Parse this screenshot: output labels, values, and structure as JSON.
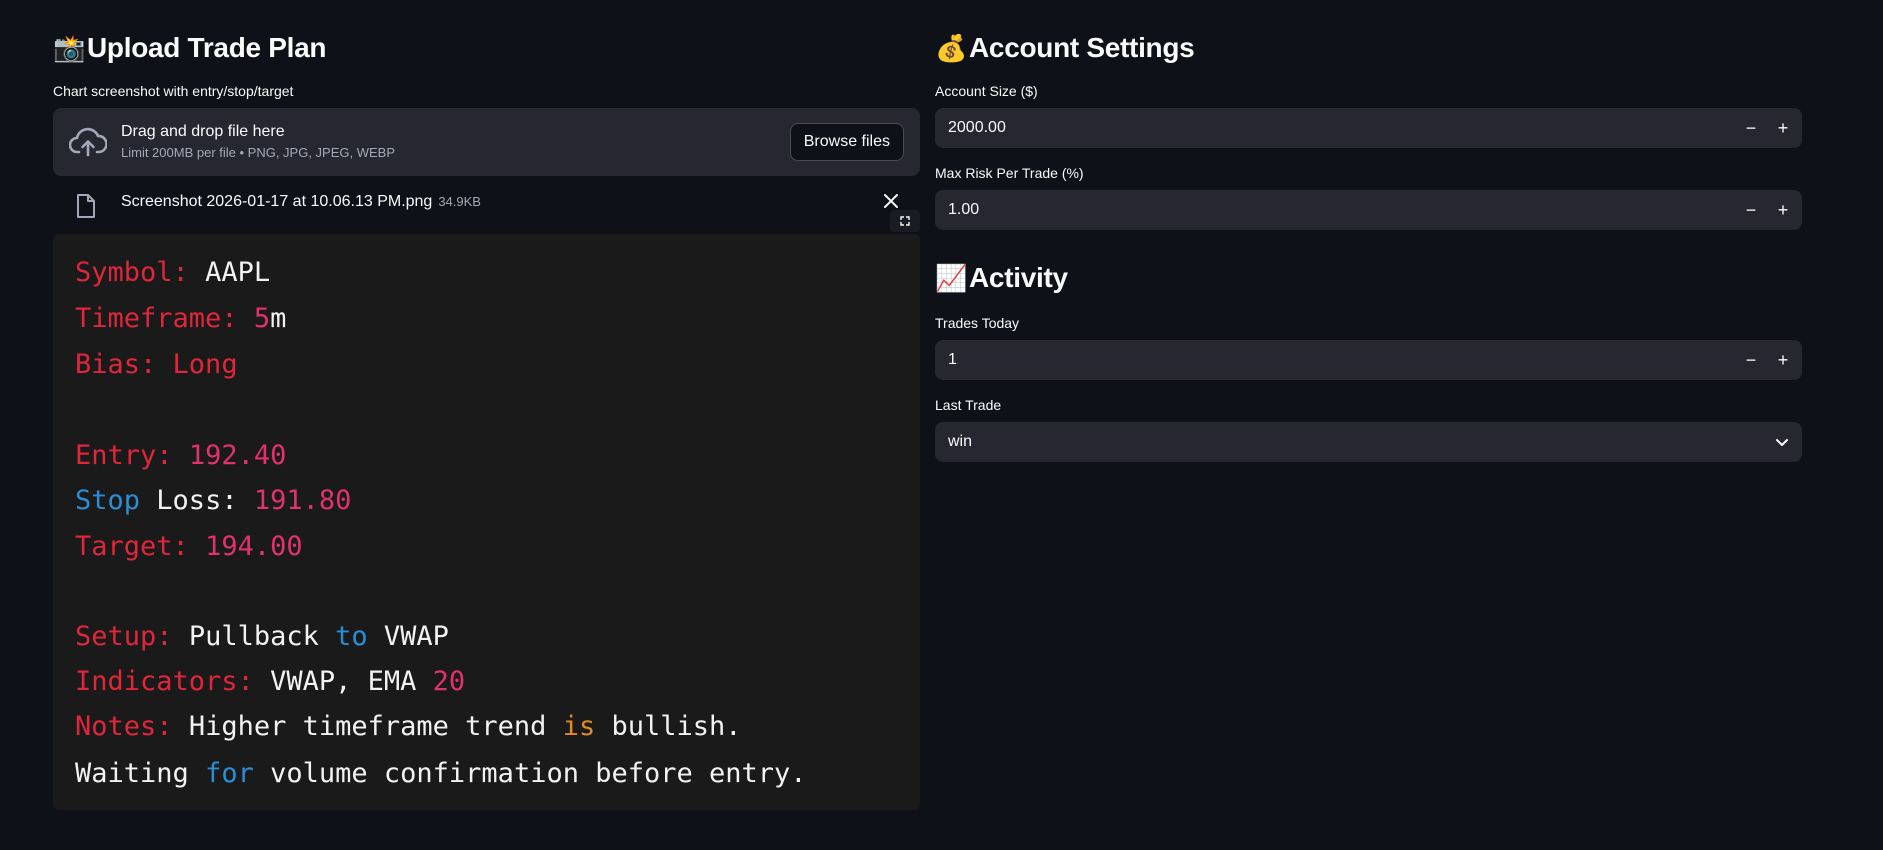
{
  "upload": {
    "title_emoji": "📸",
    "title": "Upload Trade Plan",
    "label": "Chart screenshot with entry/stop/target",
    "dropzone_title": "Drag and drop file here",
    "dropzone_sub": "Limit 200MB per file • PNG, JPG, JPEG, WEBP",
    "browse_label": "Browse files",
    "file_name": "Screenshot 2026-01-17 at 10.06.13 PM.png",
    "file_size": "34.9KB"
  },
  "preview": {
    "symbol_key": "Symbol:",
    "symbol_val": "AAPL",
    "timeframe_key": "Timeframe:",
    "timeframe_num": "5",
    "timeframe_unit": "m",
    "bias_key": "Bias:",
    "bias_val": "Long",
    "entry_key": "Entry:",
    "entry_val": "192.40",
    "stop_word": "Stop",
    "loss_word": "Loss:",
    "stop_val": "191.80",
    "target_key": "Target:",
    "target_val": "194.00",
    "setup_key": "Setup:",
    "setup_a": "Pullback",
    "setup_to": "to",
    "setup_b": "VWAP",
    "ind_key": "Indicators:",
    "ind_a": "VWAP, EMA",
    "ind_num": "20",
    "notes_key": "Notes:",
    "notes_a": "Higher timeframe trend",
    "notes_is": "is",
    "notes_b": "bullish.",
    "line2_a": "Waiting",
    "line2_for": "for",
    "line2_b": "volume confirmation before entry."
  },
  "account": {
    "title_emoji": "💰",
    "title": "Account Settings",
    "size_label": "Account Size ($)",
    "size_value": "2000.00",
    "risk_label": "Max Risk Per Trade (%)",
    "risk_value": "1.00"
  },
  "activity": {
    "title_emoji": "📈",
    "title": "Activity",
    "trades_label": "Trades Today",
    "trades_value": "1",
    "last_label": "Last Trade",
    "last_value": "win"
  },
  "stepper": {
    "minus": "−",
    "plus": "+"
  },
  "icons": {
    "upload": "cloud-upload-icon",
    "file": "file-icon",
    "close": "close-icon",
    "expand": "fullscreen-icon",
    "chevron": "chevron-down-icon"
  },
  "colors": {
    "background": "#0e1117",
    "input_bg": "#262730",
    "preview_bg": "#1a1a1a",
    "code_red": "#e0263a",
    "code_pink": "#e0326e",
    "code_blue": "#2a8ed6",
    "code_orange": "#e38a22"
  }
}
